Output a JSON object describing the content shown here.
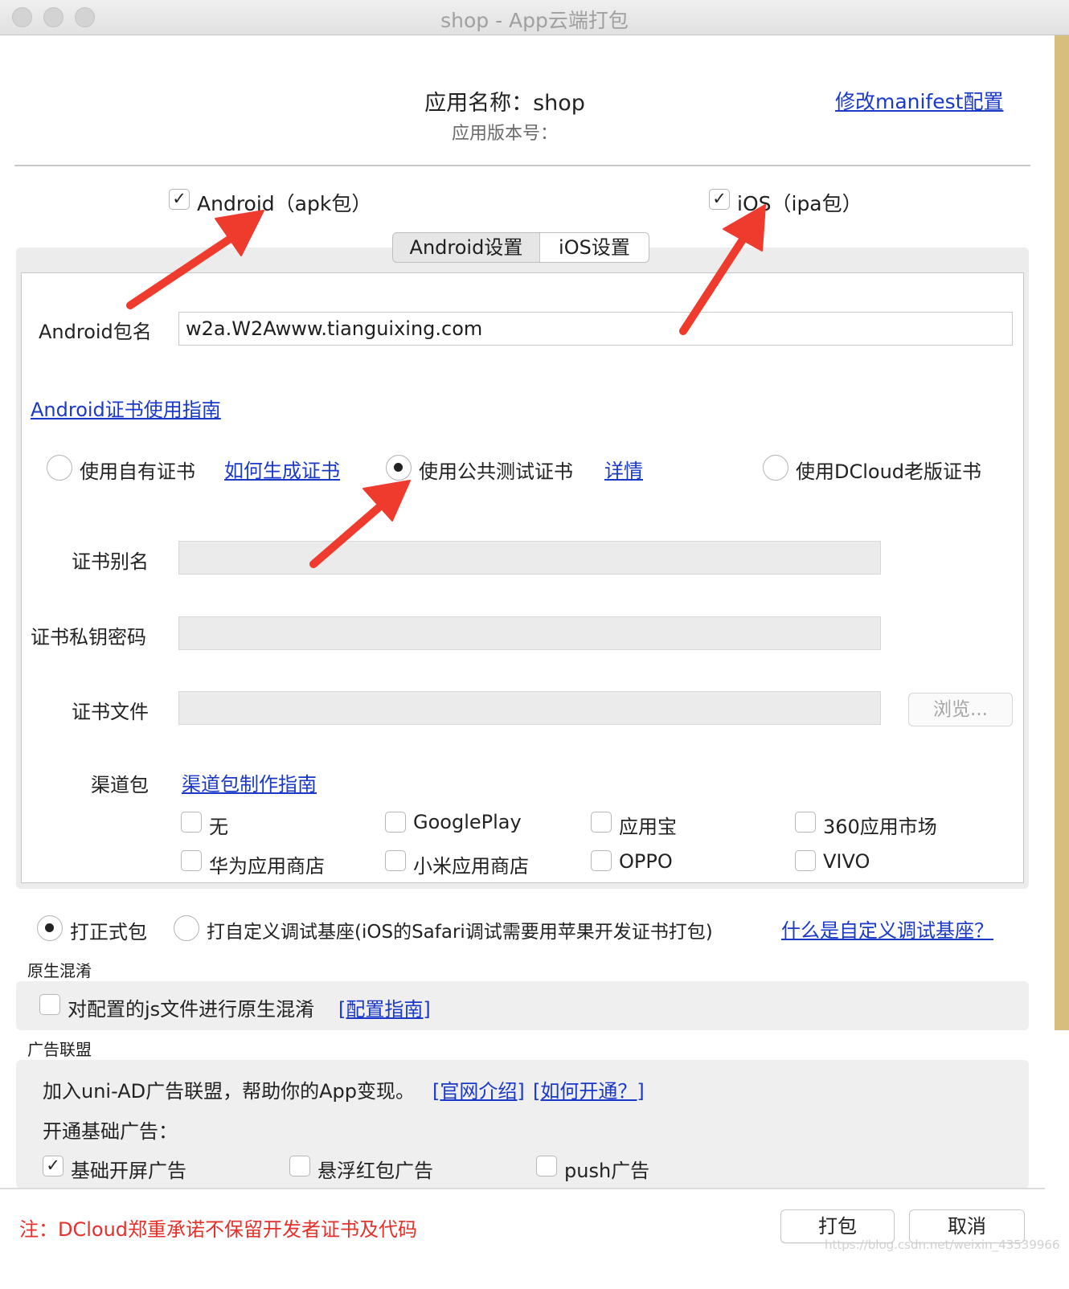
{
  "window": {
    "title": "shop - App云端打包"
  },
  "header": {
    "app_name": "应用名称：shop",
    "app_version": "应用版本号：",
    "modify_manifest_link": "修改manifest配置"
  },
  "platforms": {
    "android": {
      "label": "Android（apk包）",
      "checked": true
    },
    "ios": {
      "label": "iOS（ipa包）",
      "checked": true
    }
  },
  "tabs": [
    {
      "label": "Android设置",
      "active": true
    },
    {
      "label": "iOS设置",
      "active": false
    }
  ],
  "android": {
    "package_label": "Android包名",
    "package_value": "w2a.W2Awww.tianguixing.com",
    "cert_guide_link": "Android证书使用指南",
    "cert_options": {
      "own": {
        "label": "使用自有证书",
        "link": "如何生成证书",
        "selected": false
      },
      "public_test": {
        "label": "使用公共测试证书",
        "link": "详情",
        "selected": true
      },
      "dcloud_old": {
        "label": "使用DCloud老版证书",
        "selected": false
      }
    },
    "cert_alias_label": "证书别名",
    "cert_password_label": "证书私钥密码",
    "cert_file_label": "证书文件",
    "browse_button": "浏览...",
    "channel_label": "渠道包",
    "channel_guide_link": "渠道包制作指南",
    "channels": [
      "无",
      "GooglePlay",
      "应用宝",
      "360应用市场",
      "华为应用商店",
      "小米应用商店",
      "OPPO",
      "VIVO"
    ]
  },
  "build_type": {
    "release": {
      "label": "打正式包",
      "selected": true
    },
    "custom_debug": {
      "label": "打自定义调试基座(iOS的Safari调试需要用苹果开发证书打包)",
      "selected": false
    },
    "help_link": "什么是自定义调试基座？"
  },
  "obfuscation": {
    "section_title": "原生混淆",
    "checkbox_label": "对配置的js文件进行原生混淆",
    "guide_link": "[配置指南]",
    "checked": false
  },
  "ads": {
    "section_title": "广告联盟",
    "intro_text": "加入uni-AD广告联盟，帮助你的App变现。",
    "official_link": "[官网介绍]",
    "how_link": "[如何开通？]",
    "basic_ads_label": "开通基础广告：",
    "options": [
      {
        "label": "基础开屏广告",
        "checked": true
      },
      {
        "label": "悬浮红包广告",
        "checked": false
      },
      {
        "label": "push广告",
        "checked": false
      }
    ]
  },
  "footer": {
    "notice": "注：DCloud郑重承诺不保留开发者证书及代码",
    "pack_button": "打包",
    "cancel_button": "取消",
    "watermark": "https://blog.csdn.net/weixin_43539966"
  },
  "colors": {
    "link": "#1a39c8",
    "notice": "#e6302a",
    "arrow": "#ee3b2e"
  }
}
